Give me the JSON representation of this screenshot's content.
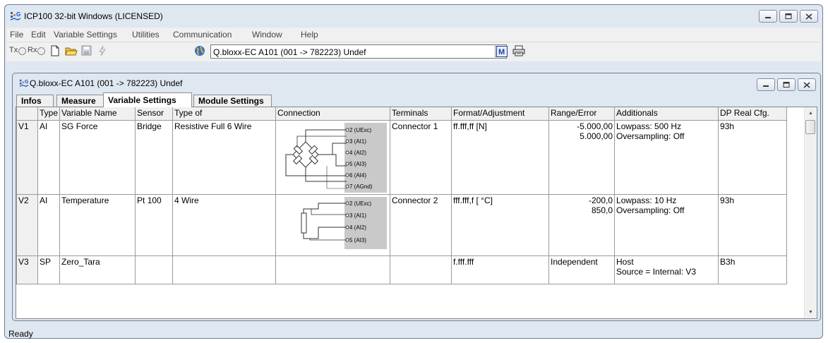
{
  "app": {
    "title": "ICP100 32-bit Windows  (LICENSED)",
    "logo_letters": "ICP"
  },
  "menu": [
    "File",
    "Edit",
    "Variable Settings",
    "Utilities",
    "Communication",
    "Window",
    "Help"
  ],
  "toolbar": {
    "tx_label": "Tx",
    "rx_label": "Rx",
    "device_selected": "Q.bloxx-EC A101 (001 -> 782223) Undef",
    "m_button": "M"
  },
  "child": {
    "title": "Q.bloxx-EC A101 (001 -> 782223) Undef"
  },
  "tabs": [
    "Infos",
    "Measure",
    "Variable Settings",
    "Module Settings"
  ],
  "table": {
    "columns": [
      "",
      "Type",
      "Variable Name",
      "Sensor",
      "Type of",
      "Connection",
      "Terminals",
      "Format/Adjustment",
      "Range/Error",
      "Additionals",
      "DP Real Cfg."
    ],
    "rows": [
      {
        "id": "V1",
        "type": "AI",
        "name": "SG Force",
        "sensor": "Bridge",
        "type_of": "Resistive Full 6 Wire",
        "terminals": "Connector 1",
        "format": "ff.fff,ff [N]",
        "range_1": "-5.000,00",
        "range_2": "5.000,00",
        "add_1": "Lowpass: 500 Hz",
        "add_2": "Oversampling: Off",
        "dp": "93h",
        "pins": [
          "2 (UExc)",
          "3 (AI1)",
          "4 (AI2)",
          "5 (AI3)",
          "6 (AI4)",
          "7 (AGnd)"
        ]
      },
      {
        "id": "V2",
        "type": "AI",
        "name": "Temperature",
        "sensor": "Pt 100",
        "type_of": "4 Wire",
        "terminals": "Connector 2",
        "format": "fff.fff,f [ °C]",
        "range_1": "-200,0",
        "range_2": "850,0",
        "add_1": "Lowpass: 10 Hz",
        "add_2": "Oversampling: Off",
        "dp": "93h",
        "pins": [
          "2 (UExc)",
          "3 (AI1)",
          "4 (AI2)",
          "5 (AI3)"
        ]
      },
      {
        "id": "V3",
        "type": "SP",
        "name": "Zero_Tara",
        "sensor": "",
        "type_of": "",
        "terminals": "",
        "format": "f.fff.fff",
        "range_1": "Independent",
        "range_2": "",
        "add_1": "Host",
        "add_2": "Source = Internal: V3",
        "dp": "B3h"
      }
    ]
  },
  "status": {
    "text": "Ready"
  },
  "icons": [
    "new-file-icon",
    "open-folder-icon",
    "save-icon",
    "lightning-icon",
    "globe-icon",
    "printer-icon"
  ]
}
